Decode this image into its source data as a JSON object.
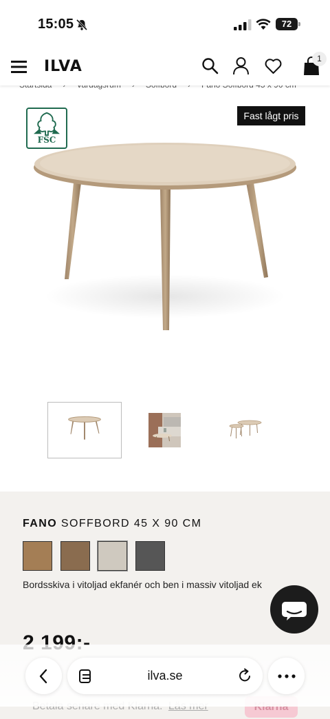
{
  "status": {
    "time": "15:05",
    "battery": "72"
  },
  "header": {
    "logo": "ILVA",
    "cart_count": "1"
  },
  "breadcrumb": [
    "Startsida",
    "›",
    "Vardagsrum",
    "›",
    "Soffbord",
    "›",
    "Fano Soffbord 45 x 90 cm"
  ],
  "product": {
    "badge": "Fast lågt pris",
    "fsc_label": "FSC",
    "title_brand": "FANO",
    "title_rest": "SOFFBORD 45 X 90 CM",
    "swatches": [
      "#a47e55",
      "#8a6c4f",
      "#cfc9bf",
      "#565656"
    ],
    "selected_swatch": 3,
    "description": "Bordsskiva i vitoljad ekfanér och ben i massiv vitoljad ek",
    "price": "2 199:-"
  },
  "klarna": {
    "text": "Betala senare med Klarna.",
    "link": "Läs mer",
    "badge": "Klarna"
  },
  "browser": {
    "url": "ilva.se"
  }
}
